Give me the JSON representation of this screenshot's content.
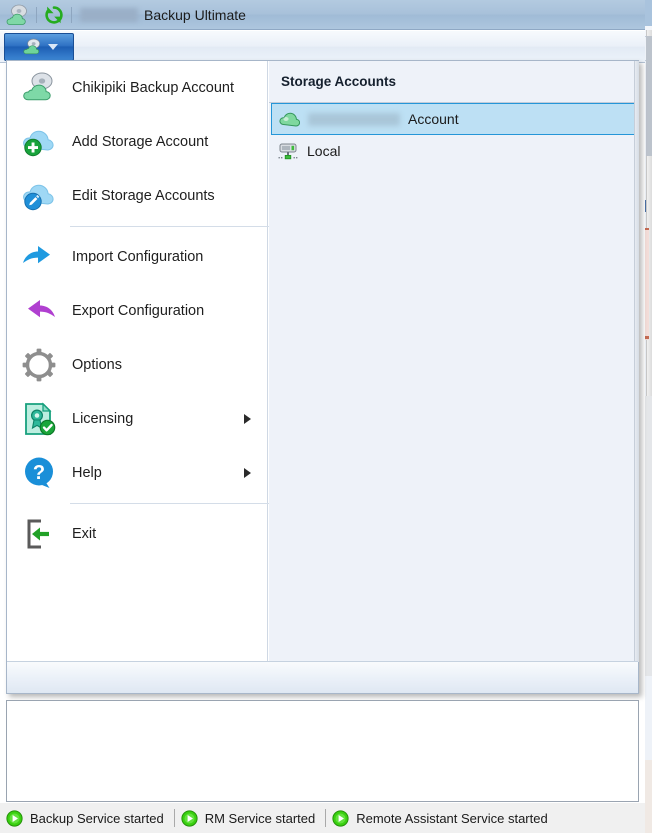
{
  "titlebar": {
    "app_icon": "cloud-backup-icon",
    "refresh_icon": "refresh-icon",
    "redacted_brand": "",
    "title": "Backup Ultimate"
  },
  "toolbar": {
    "menu_button_icon": "cloud-backup-icon",
    "menu_button_caret": "chevron-down-icon"
  },
  "menu": {
    "items": [
      {
        "label": "Chikipiki Backup Account",
        "icon": "cloud-account-icon",
        "submenu": false,
        "separator_after": false
      },
      {
        "label": "Add Storage Account",
        "icon": "cloud-plus-icon",
        "submenu": false,
        "separator_after": false
      },
      {
        "label": "Edit Storage Accounts",
        "icon": "cloud-pencil-icon",
        "submenu": false,
        "separator_after": true
      },
      {
        "label": "Import Configuration",
        "icon": "import-arrow-icon",
        "submenu": false,
        "separator_after": false
      },
      {
        "label": "Export Configuration",
        "icon": "export-arrow-icon",
        "submenu": false,
        "separator_after": false
      },
      {
        "label": "Options",
        "icon": "gear-icon",
        "submenu": false,
        "separator_after": false
      },
      {
        "label": "Licensing",
        "icon": "certificate-check-icon",
        "submenu": true,
        "separator_after": false
      },
      {
        "label": "Help",
        "icon": "question-bubble-icon",
        "submenu": true,
        "separator_after": true
      },
      {
        "label": "Exit",
        "icon": "exit-arrow-icon",
        "submenu": false,
        "separator_after": false
      }
    ]
  },
  "storage_accounts": {
    "header": "Storage Accounts",
    "rows": [
      {
        "redacted_prefix": true,
        "label": "Account",
        "icon": "cloud-green-icon",
        "selected": true
      },
      {
        "redacted_prefix": false,
        "label": "Local",
        "icon": "local-drive-icon",
        "selected": false
      }
    ]
  },
  "statusbar": {
    "items": [
      {
        "label": "Backup Service started",
        "icon": "service-running-icon"
      },
      {
        "label": "RM Service started",
        "icon": "service-running-icon"
      },
      {
        "label": "Remote Assistant Service started",
        "icon": "service-running-icon"
      }
    ]
  },
  "colors": {
    "titlebar": "#a8c1da",
    "accent_blue": "#1d5fb4",
    "selection": "#bde0f4",
    "selection_border": "#2596d8",
    "status_green": "#36c410"
  }
}
